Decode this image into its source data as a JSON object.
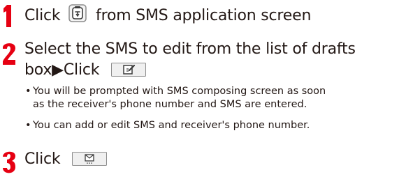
{
  "steps": [
    {
      "number": "1",
      "line1_a": "Click",
      "line1_b": "from SMS application screen",
      "icon": "sms-compose-new-icon"
    },
    {
      "number": "2",
      "line1": "Select the SMS to edit from the list of drafts",
      "line2_a": "box▶Click",
      "icon": "edit-button-icon"
    },
    {
      "number": "3",
      "line1_a": "Click",
      "icon": "send-message-button-icon"
    }
  ],
  "notes": [
    {
      "bullet": "•",
      "line1": "You will be prompted with SMS composing screen as soon",
      "line2": "as the receiver's phone number and SMS are entered."
    },
    {
      "bullet": "•",
      "line1": "You can add or edit SMS and receiver's phone number."
    }
  ],
  "colors": {
    "step_number": "#e60012",
    "text": "#231815",
    "button_face": "#f0f0f0",
    "button_border": "#8c8c8c"
  }
}
